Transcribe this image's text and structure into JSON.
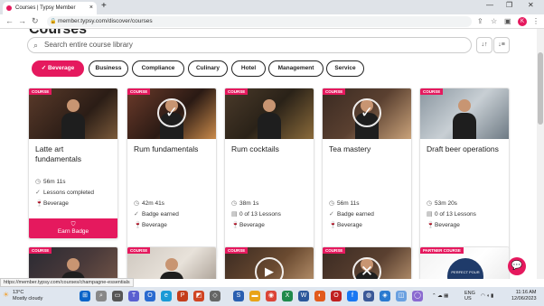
{
  "browser": {
    "tab_title": "Courses | Typsy Member",
    "tab_close": "×",
    "new_tab": "+",
    "url": "member.typsy.com/discover/courses",
    "status_url": "https://member.typsy.com/courses/champagne-essentials"
  },
  "page": {
    "title": "Courses",
    "search_placeholder": "Search entire course library"
  },
  "filters": [
    {
      "label": "Beverage",
      "active": true
    },
    {
      "label": "Business",
      "active": false
    },
    {
      "label": "Compliance",
      "active": false
    },
    {
      "label": "Culinary",
      "active": false
    },
    {
      "label": "Hotel",
      "active": false
    },
    {
      "label": "Management",
      "active": false
    },
    {
      "label": "Service",
      "active": false
    }
  ],
  "cards_row1": [
    {
      "badge": "COURSE",
      "title": "Latte art fundamentals",
      "duration": "56m 11s",
      "status": "Lessons completed",
      "category": "Beverage",
      "button": "Earn Badge",
      "overlay": ""
    },
    {
      "badge": "COURSE",
      "title": "Rum fundamentals",
      "duration": "42m 41s",
      "status": "Badge earned",
      "category": "Beverage",
      "button": "",
      "overlay": "✓"
    },
    {
      "badge": "COURSE",
      "title": "Rum cocktails",
      "duration": "38m 1s",
      "status": "0 of 13 Lessons",
      "category": "Beverage",
      "button": "",
      "overlay": ""
    },
    {
      "badge": "COURSE",
      "title": "Tea mastery",
      "duration": "56m 11s",
      "status": "Badge earned",
      "category": "Beverage",
      "button": "",
      "overlay": "✓"
    },
    {
      "badge": "COURSE",
      "title": "Draft beer operations",
      "duration": "53m 20s",
      "status": "0 of 13 Lessons",
      "category": "Beverage",
      "button": "",
      "overlay": ""
    }
  ],
  "cards_row2": [
    {
      "badge": "COURSE",
      "overlay": ""
    },
    {
      "badge": "COURSE",
      "overlay": ""
    },
    {
      "badge": "COURSE",
      "overlay": "▶"
    },
    {
      "badge": "COURSE",
      "overlay": "✕"
    },
    {
      "badge": "PARTNER COURSE",
      "overlay": "",
      "logo_text": "PERFECT POUR"
    }
  ],
  "taskbar": {
    "temp": "13°C",
    "weather": "Mostly cloudy",
    "lang1": "ENG",
    "lang2": "US",
    "time": "11:16 AM",
    "date": "12/06/2023"
  },
  "colors": {
    "accent": "#e5195e"
  }
}
